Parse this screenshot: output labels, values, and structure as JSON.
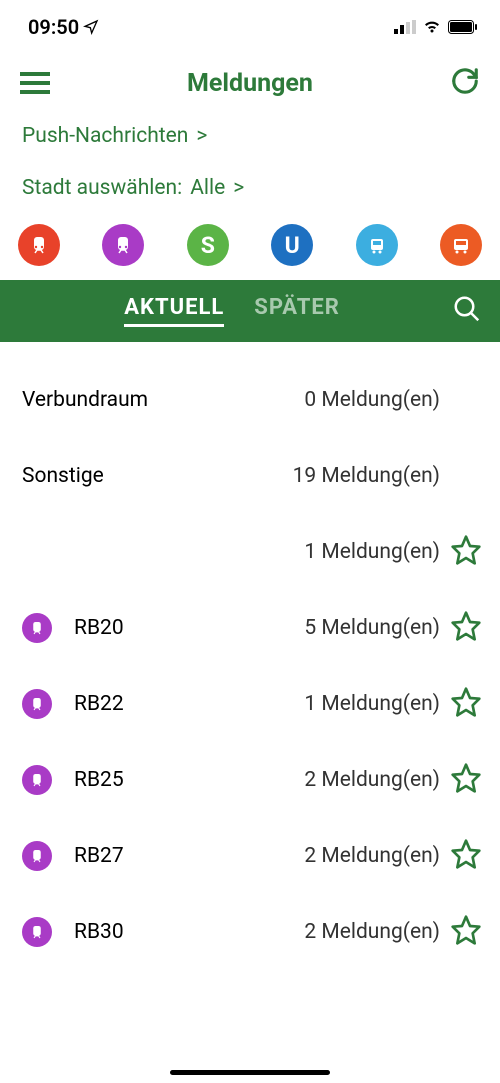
{
  "status": {
    "time": "09:50"
  },
  "header": {
    "title": "Meldungen"
  },
  "filters": {
    "push": "Push-Nachrichten",
    "push_chevron": ">",
    "city_label": "Stadt auswählen:",
    "city_value": "Alle",
    "city_chevron": ">"
  },
  "transport_modes": [
    {
      "name": "re",
      "color": "#e8422a",
      "glyph": "train"
    },
    {
      "name": "rb",
      "color": "#a93bc6",
      "glyph": "train"
    },
    {
      "name": "sbahn",
      "color": "#5bb446",
      "glyph": "S"
    },
    {
      "name": "ubahn",
      "color": "#1e70c1",
      "glyph": "U"
    },
    {
      "name": "tram",
      "color": "#3caee0",
      "glyph": "tram"
    },
    {
      "name": "bus",
      "color": "#ec5b24",
      "glyph": "bus"
    }
  ],
  "tabs": {
    "current": "AKTUELL",
    "later": "SPÄTER"
  },
  "rows": [
    {
      "type": "plain",
      "name": "Verbundraum",
      "count": "0 Meldung(en)"
    },
    {
      "type": "plain",
      "name": "Sonstige",
      "count": "19 Meldung(en)"
    },
    {
      "type": "star-only",
      "name": "",
      "count": "1 Meldung(en)"
    },
    {
      "type": "line",
      "name": "RB20",
      "count": "5 Meldung(en)"
    },
    {
      "type": "line",
      "name": "RB22",
      "count": "1 Meldung(en)"
    },
    {
      "type": "line",
      "name": "RB25",
      "count": "2 Meldung(en)"
    },
    {
      "type": "line",
      "name": "RB27",
      "count": "2 Meldung(en)"
    },
    {
      "type": "line",
      "name": "RB30",
      "count": "2 Meldung(en)"
    }
  ],
  "colors": {
    "primary": "#2d7a3a",
    "rb_line": "#a93bc6"
  }
}
